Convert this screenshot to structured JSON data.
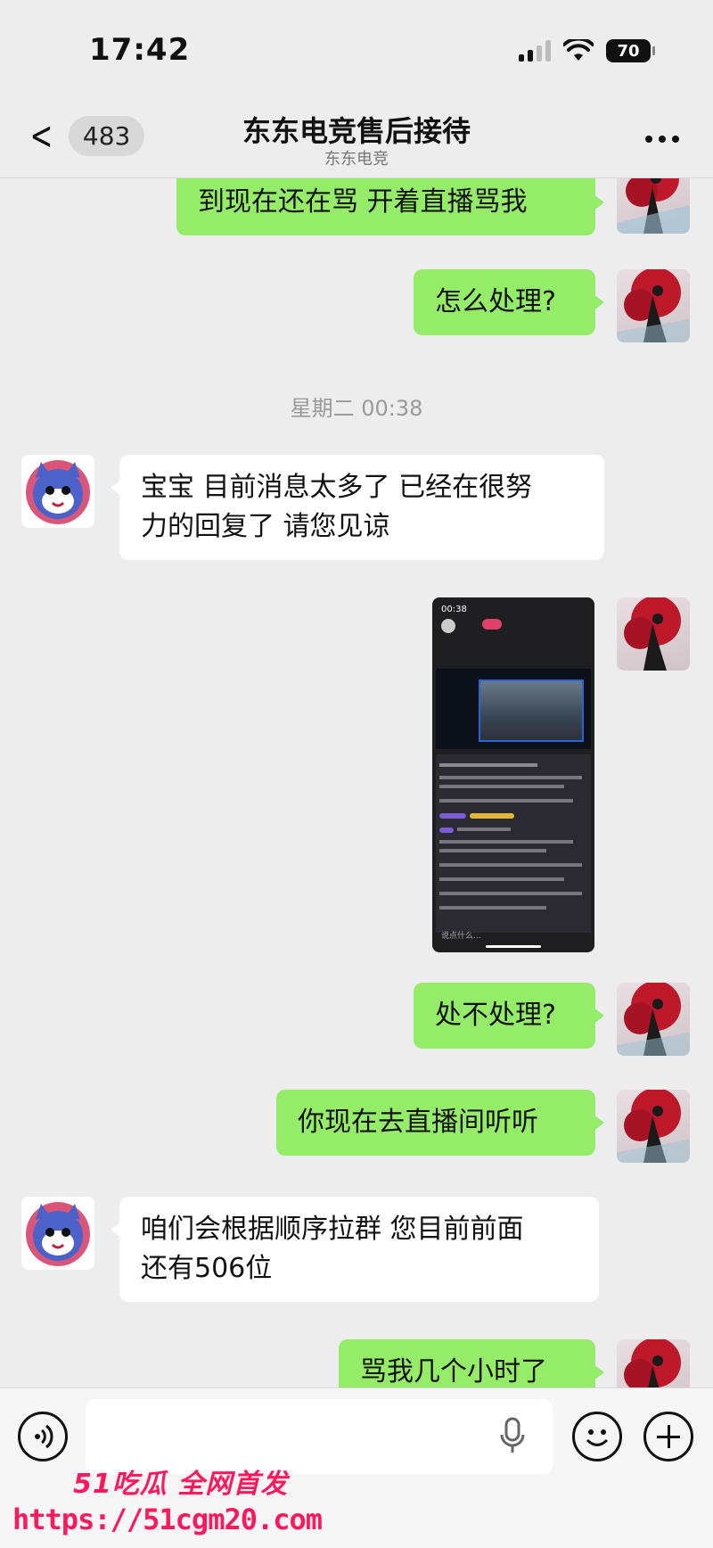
{
  "status_bar": {
    "time": "17:42",
    "battery": "70"
  },
  "header": {
    "back_count": "483",
    "title": "东东电竞售后接待",
    "subtitle": "东东电竞"
  },
  "messages": [
    {
      "side": "right",
      "text": "到现在还在骂 开着直播骂我"
    },
    {
      "side": "right",
      "text": "怎么处理?"
    },
    {
      "side": "left",
      "text": "宝宝 目前消息太多了 已经在很努力的回复了 请您见谅",
      "lines": [
        "宝宝 目前消息太多了 已经在很努",
        "力的回复了 请您见谅"
      ]
    },
    {
      "side": "right",
      "type": "image",
      "desc": "screenshot"
    },
    {
      "side": "right",
      "text": "处不处理?"
    },
    {
      "side": "right",
      "text": "你现在去直播间听听"
    },
    {
      "side": "left",
      "text": "咱们会根据顺序拉群 您目前前面还有506位",
      "lines": [
        "咱们会根据顺序拉群 您目前前面",
        "还有506位"
      ]
    },
    {
      "side": "right",
      "text": "骂我几个小时了"
    }
  ],
  "timestamp": "星期二 00:38",
  "screenshot": {
    "time": "00:38",
    "input_placeholder": "说点什么..."
  },
  "watermark": {
    "brand": "51吃瓜 全网首发",
    "url": "https://51cgm20.com"
  },
  "colors": {
    "accent": "#95ec69",
    "watermark": "#ff1a5e",
    "background": "#ededed"
  }
}
